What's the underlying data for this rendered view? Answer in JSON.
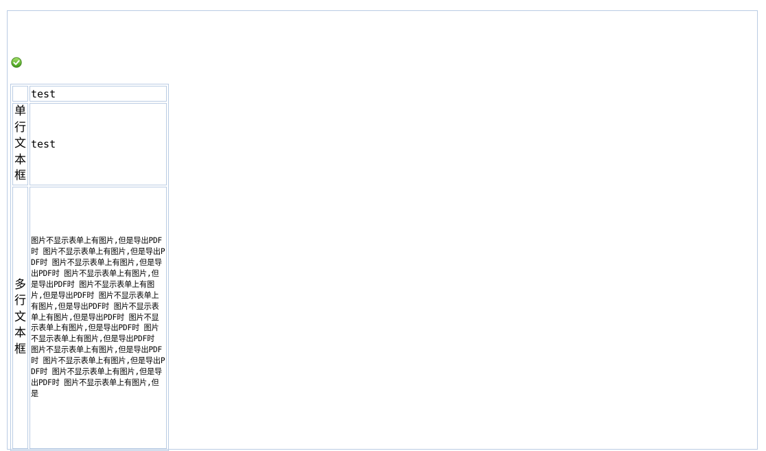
{
  "status_icon": "check-circle-icon",
  "colors": {
    "border": "#b9cbe3",
    "icon_green": "#5fb82e"
  },
  "form": {
    "header_value": "test",
    "single_line": {
      "label": "单行文本框",
      "value": "test"
    },
    "multi_line": {
      "label": "多行文本框",
      "value": "图片不显示表单上有图片,但是导出PDF时 图片不显示表单上有图片,但是导出PDF时 图片不显示表单上有图片,但是导出PDF时 图片不显示表单上有图片,但是导出PDF时 图片不显示表单上有图片,但是导出PDF时 图片不显示表单上有图片,但是导出PDF时 图片不显示表单上有图片,但是导出PDF时 图片不显示表单上有图片,但是导出PDF时 图片不显示表单上有图片,但是导出PDF时 图片不显示表单上有图片,但是导出PDF时 图片不显示表单上有图片,但是导出PDF时 图片不显示表单上有图片,但是导出PDF时 图片不显示表单上有图片,但是"
    }
  }
}
